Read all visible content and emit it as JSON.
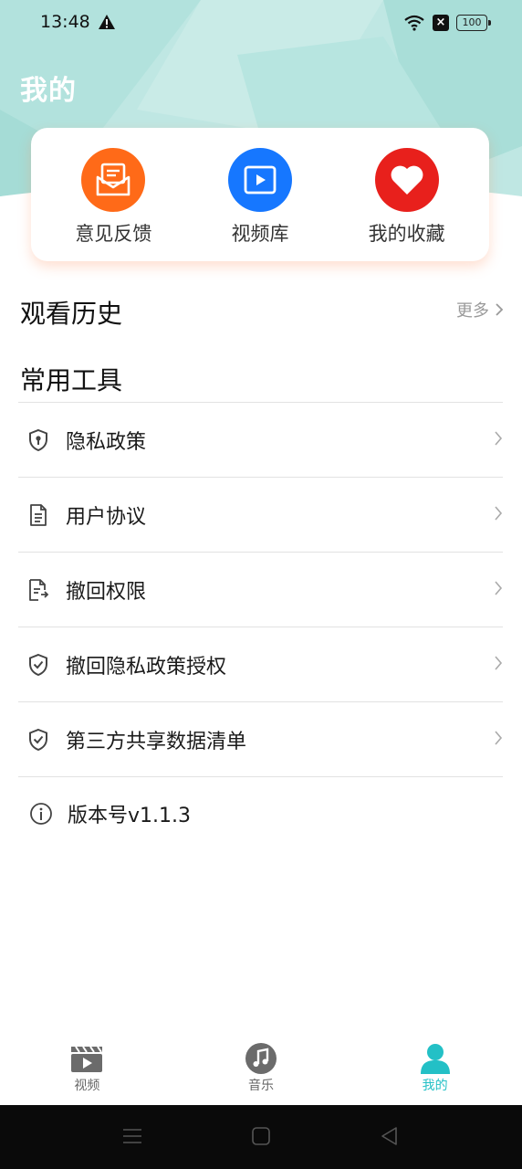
{
  "status_bar": {
    "time": "13:48",
    "battery": "100",
    "sim": "×",
    "icons": [
      "warning-icon",
      "wifi-icon",
      "no-sim-icon",
      "battery-icon"
    ]
  },
  "header": {
    "title": "我的",
    "background_color": "#bfe7e3"
  },
  "quick_actions": [
    {
      "label": "意见反馈",
      "icon": "mail-icon",
      "color": "#ff6a18"
    },
    {
      "label": "视频库",
      "icon": "video-library-icon",
      "color": "#1677ff"
    },
    {
      "label": "我的收藏",
      "icon": "heart-icon",
      "color": "#e8201c"
    }
  ],
  "history": {
    "title": "观看历史",
    "more": "更多"
  },
  "tools": {
    "title": "常用工具",
    "items": [
      {
        "label": "隐私政策",
        "icon": "shield-lock-icon"
      },
      {
        "label": "用户协议",
        "icon": "document-icon"
      },
      {
        "label": "撤回权限",
        "icon": "document-edit-icon"
      },
      {
        "label": "撤回隐私政策授权",
        "icon": "shield-check-icon"
      },
      {
        "label": "第三方共享数据清单",
        "icon": "shield-check-icon"
      }
    ],
    "version": {
      "label": "版本号v1.1.3",
      "icon": "info-icon"
    }
  },
  "bottom_nav": {
    "active_color": "#23c0c6",
    "tabs": [
      {
        "label": "视频",
        "icon": "clapperboard-icon",
        "active": false
      },
      {
        "label": "音乐",
        "icon": "music-note-icon",
        "active": false
      },
      {
        "label": "我的",
        "icon": "user-icon",
        "active": true
      }
    ]
  },
  "system_nav": {
    "icons": [
      "menu-icon",
      "home-icon",
      "back-icon"
    ]
  }
}
